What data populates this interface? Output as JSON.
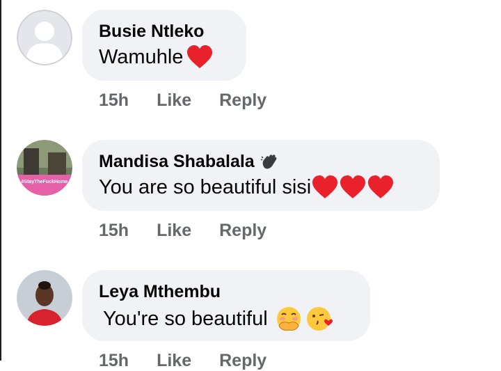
{
  "comments": [
    {
      "author": "Busie Ntleko",
      "text": "Wamuhle",
      "time": "15h",
      "like_label": "Like",
      "reply_label": "Reply",
      "avatar": "default-profile-avatar"
    },
    {
      "author": "Mandisa Shabalala",
      "text": "You are so beautiful sisi",
      "time": "15h",
      "like_label": "Like",
      "reply_label": "Reply",
      "avatar": "stay-home-frame-avatar",
      "avatar_caption": "#StayTheFuckHome"
    },
    {
      "author": "Leya Mthembu",
      "text": "You're so beautiful",
      "time": "15h",
      "like_label": "Like",
      "reply_label": "Reply",
      "avatar": "profile-photo-avatar"
    }
  ],
  "colors": {
    "bubble": "#f0f2f5",
    "meta": "#65676b",
    "heart": "#e8212b",
    "text": "#050505"
  }
}
